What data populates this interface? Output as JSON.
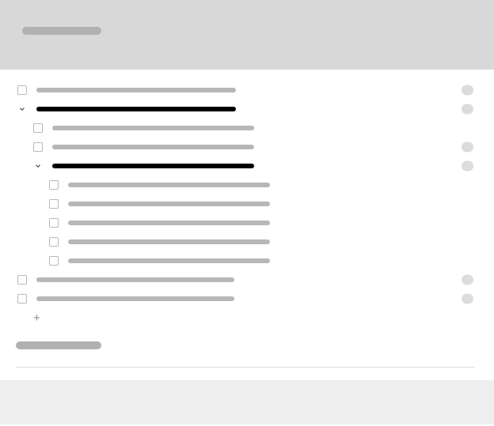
{
  "header": {
    "title": ""
  },
  "tree": {
    "items": [
      {
        "id": "item-0",
        "kind": "checkbox",
        "indent": 0,
        "label": "",
        "barClass": "w-a ph-gray",
        "badge": true
      },
      {
        "id": "item-1",
        "kind": "chevron",
        "indent": 0,
        "label": "",
        "barClass": "w-a ph-black",
        "badge": true
      },
      {
        "id": "item-1-0",
        "kind": "checkbox",
        "indent": 1,
        "label": "",
        "barClass": "w-b ph-gray",
        "badge": false
      },
      {
        "id": "item-1-1",
        "kind": "checkbox",
        "indent": 1,
        "label": "",
        "barClass": "w-b ph-gray",
        "badge": true
      },
      {
        "id": "item-1-2",
        "kind": "chevron",
        "indent": 1,
        "label": "",
        "barClass": "w-b ph-black",
        "badge": true
      },
      {
        "id": "item-1-2-0",
        "kind": "checkbox",
        "indent": 2,
        "label": "",
        "barClass": "w-c ph-gray",
        "badge": false
      },
      {
        "id": "item-1-2-1",
        "kind": "checkbox",
        "indent": 2,
        "label": "",
        "barClass": "w-c ph-gray",
        "badge": false
      },
      {
        "id": "item-1-2-2",
        "kind": "checkbox",
        "indent": 2,
        "label": "",
        "barClass": "w-c ph-gray",
        "badge": false
      },
      {
        "id": "item-1-2-3",
        "kind": "checkbox",
        "indent": 2,
        "label": "",
        "barClass": "w-c ph-gray",
        "badge": false
      },
      {
        "id": "item-1-2-4",
        "kind": "checkbox",
        "indent": 2,
        "label": "",
        "barClass": "w-c ph-gray",
        "badge": false
      },
      {
        "id": "item-2",
        "kind": "checkbox",
        "indent": 0,
        "label": "",
        "barClass": "w-d ph-gray",
        "badge": true
      },
      {
        "id": "item-3",
        "kind": "checkbox",
        "indent": 0,
        "label": "",
        "barClass": "w-d ph-gray",
        "badge": true
      }
    ],
    "add_label": "+"
  },
  "footer": {
    "note": ""
  },
  "colors": {
    "placeholder_gray": "#b7b7b7",
    "placeholder_dark": "#000000",
    "badge": "#dcdcdc",
    "header_bg": "#d8d8d8"
  }
}
